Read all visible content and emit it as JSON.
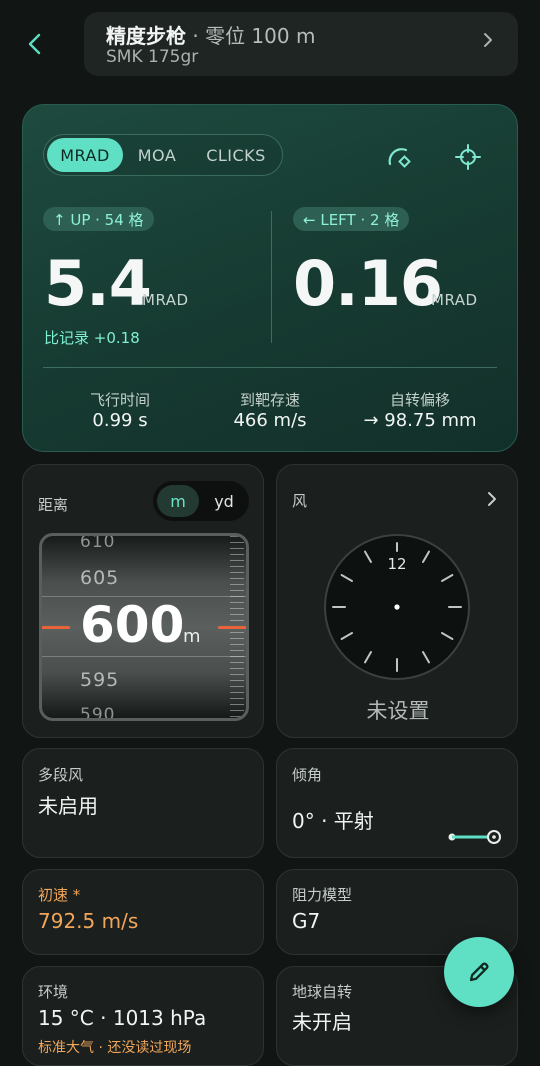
{
  "header": {
    "back_icon": "chevron-left-icon",
    "profile_name": "精度步枪",
    "profile_zero": "· 零位 100 m",
    "ammo": "SMK 175gr",
    "chevron_icon": "chevron-right-icon"
  },
  "solution": {
    "units": [
      "MRAD",
      "MOA",
      "CLICKS"
    ],
    "active_unit": "MRAD",
    "icons": [
      "reticle-arc-icon",
      "crosshair-icon"
    ],
    "elevation": {
      "badge": "↑ UP · 54 格",
      "value": "5.4",
      "unit": "MRAD",
      "compare": "比记录 +0.18"
    },
    "windage": {
      "badge": "← LEFT · 2 格",
      "value": "0.16",
      "unit": "MRAD"
    },
    "stats": [
      {
        "label": "飞行时间",
        "value": "0.99 s"
      },
      {
        "label": "到靶存速",
        "value": "466 m/s"
      },
      {
        "label": "自转偏移",
        "value": "→ 98.75 mm"
      }
    ]
  },
  "distance": {
    "label": "距离",
    "units": [
      "m",
      "yd"
    ],
    "active_unit": "m",
    "wheel": {
      "above": [
        "610",
        "605"
      ],
      "current": "600",
      "unit": "m",
      "below": [
        "595",
        "590"
      ]
    }
  },
  "wind": {
    "label": "风",
    "clock_label": "12",
    "status": "未设置"
  },
  "multi_wind": {
    "label": "多段风",
    "value": "未启用"
  },
  "incline": {
    "label": "倾角",
    "value": "0° · 平射",
    "slider": 0
  },
  "muzzle": {
    "label": "初速 *",
    "value": "792.5 m/s",
    "accent": "#f2a65a"
  },
  "drag": {
    "label": "阻力模型",
    "value": "G7"
  },
  "environment": {
    "label": "环境",
    "value": "15 °C · 1013 hPa",
    "note": "标准大气 · 还没读过现场"
  },
  "coriolis": {
    "label": "地球自转",
    "value": "未开启"
  },
  "fab": {
    "icon": "pencil-icon"
  },
  "colors": {
    "accent": "#5fe0c4",
    "warning": "#f2a65a",
    "marker": "#e8623a"
  }
}
